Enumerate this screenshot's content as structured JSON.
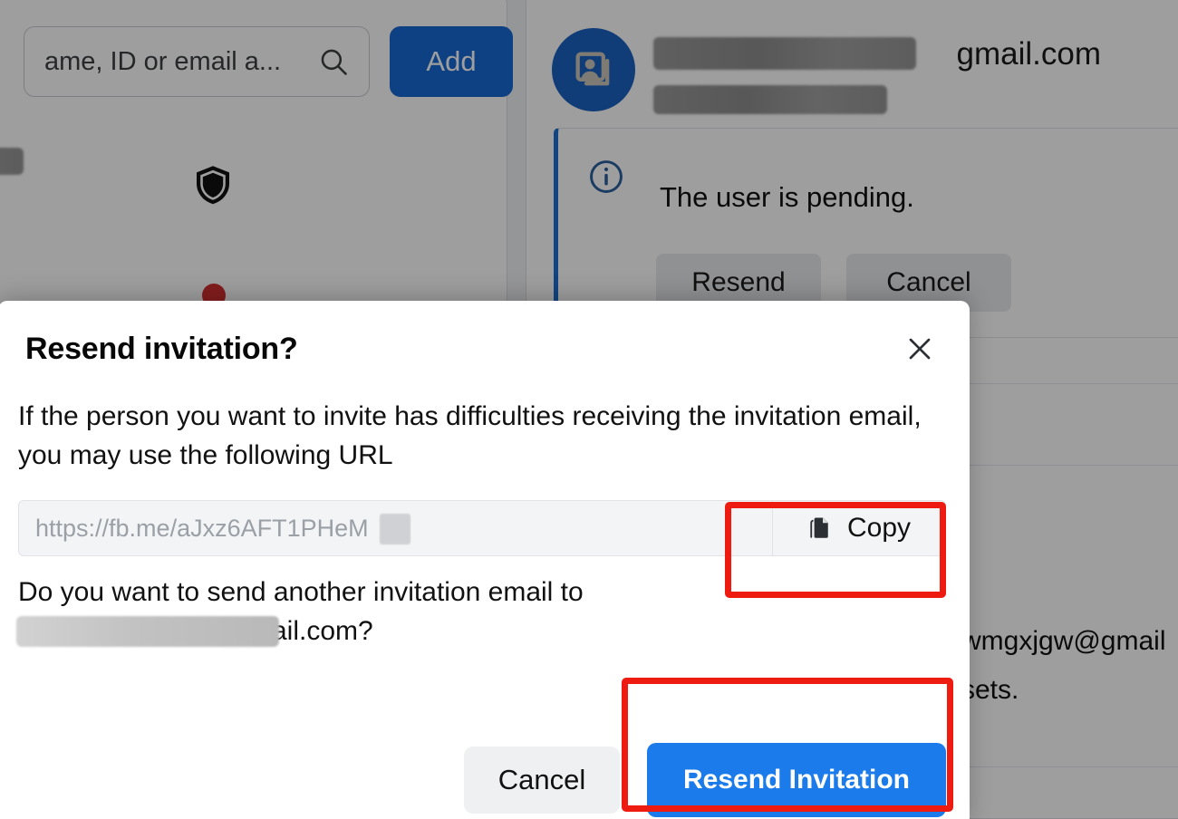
{
  "background": {
    "search": {
      "placeholder_visible": "ame, ID or email a...",
      "icon": "search-icon"
    },
    "add_button": {
      "label": "Add"
    },
    "shield_icon": "shield-icon",
    "avatar_icon": "contact-card-icon",
    "user": {
      "email_suffix": "gmail.com",
      "redacted_name": ""
    },
    "notice": {
      "icon": "info-circle-icon",
      "text": "The user is pending.",
      "resend_label": "Resend",
      "cancel_label": "Cancel"
    },
    "side_text": {
      "email_fragment": "wmgxjgw@gmail",
      "word_fragment": "sets."
    }
  },
  "dialog": {
    "title": "Resend invitation?",
    "close_icon": "close-icon",
    "paragraph": "If the person you want to invite has difficulties receiving the invitation email, you may use the following URL",
    "url": {
      "value": "https://fb.me/aJxz6AFT1PHeM",
      "copy_label": "Copy",
      "copy_icon": "copy-icon"
    },
    "question_line1": "Do you want to send another invitation email to",
    "question_line2": "mail.com?",
    "cancel_label": "Cancel",
    "submit_label": "Resend Invitation"
  },
  "colors": {
    "brand_blue": "#1b7beb",
    "add_blue": "#1769d4",
    "annotation_red": "#ee1b11",
    "notice_accent": "#1b6fd2",
    "avatar_blue": "#1a61c0"
  }
}
